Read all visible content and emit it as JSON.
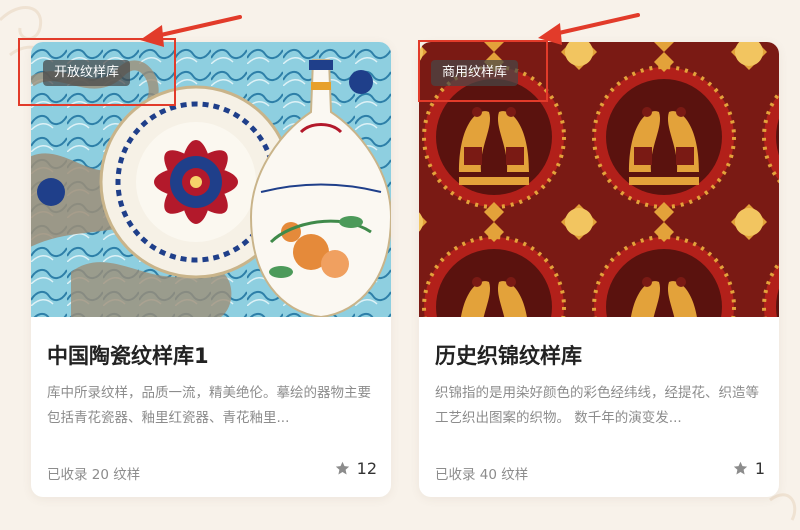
{
  "cards": [
    {
      "tag": "开放纹样库",
      "title": "中国陶瓷纹样库1",
      "description": "库中所录纹样，品质一流，精美绝伦。摹绘的器物主要包括青花瓷器、釉里红瓷器、青花釉里...",
      "count_text": "已收录 20 纹样",
      "stars": "12"
    },
    {
      "tag": "商用纹样库",
      "title": "历史织锦纹样库",
      "description": "织锦指的是用染好颜色的彩色经纬线，经提花、织造等工艺织出图案的织物。 数千年的演变发...",
      "count_text": "已收录 40 纹样",
      "stars": "1"
    }
  ],
  "colors": {
    "highlight": "#e23b2a",
    "ceramic_sky": "#8ecfe0",
    "brocade_red": "#7a1a14",
    "brocade_gold": "#e3a23a"
  },
  "icons": [
    "star-icon",
    "annotation-arrow"
  ]
}
